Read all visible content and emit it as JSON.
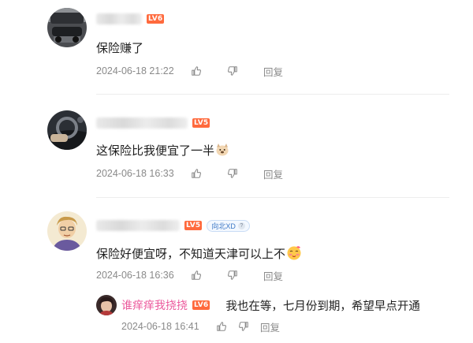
{
  "comments": [
    {
      "level": "LV6",
      "text": "保险赚了",
      "time": "2024-06-18 21:22",
      "reply_label": "回复"
    },
    {
      "level": "LV5",
      "text": "这保险比我便宜了一半",
      "time": "2024-06-18 16:33",
      "reply_label": "回复"
    },
    {
      "level": "LV5",
      "tag": "向北XD",
      "tag_help": "?",
      "text": "保险好便宜呀，不知道天津可以上不",
      "time": "2024-06-18 16:36",
      "reply_label": "回复",
      "sub_reply": {
        "name": "谁痒痒我挠挠",
        "level": "LV6",
        "text": "我也在等，七月份到期，希望早点开通",
        "time": "2024-06-18 16:41",
        "reply_label": "回复"
      }
    }
  ],
  "colors": {
    "level_badge": "#ff6a3d",
    "sub_name": "#ec5a9d",
    "meta": "#8a8a8a"
  },
  "icons": [
    "thumbs-up-icon",
    "thumbs-down-icon",
    "emoji-icon"
  ]
}
